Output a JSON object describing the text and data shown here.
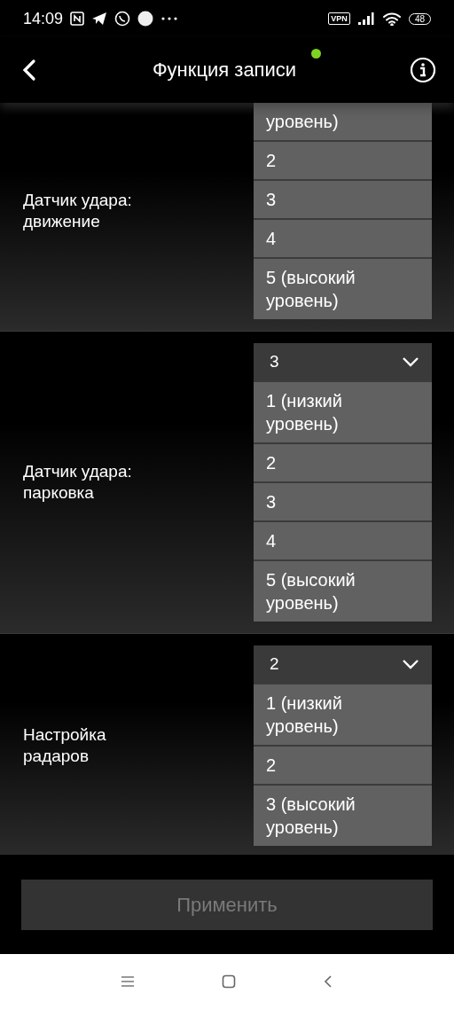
{
  "status_bar": {
    "time": "14:09",
    "vpn": "VPN",
    "battery": "48"
  },
  "header": {
    "title": "Функция записи"
  },
  "sections": [
    {
      "label": "Датчик удара: движение",
      "expanded": true,
      "options": [
        "уровень)",
        "2",
        "3",
        "4",
        "5 (высокий уровень)"
      ]
    },
    {
      "label": "Датчик удара: парковка",
      "value": "3",
      "expanded": true,
      "options": [
        "1 (низкий уровень)",
        "2",
        "3",
        "4",
        "5 (высокий уровень)"
      ]
    },
    {
      "label": "Настройка радаров",
      "value": "2",
      "expanded": true,
      "options": [
        "1 (низкий уровень)",
        "2",
        "3 (высокий уровень)"
      ]
    }
  ],
  "apply_button": {
    "label": "Применить",
    "disabled": true
  }
}
